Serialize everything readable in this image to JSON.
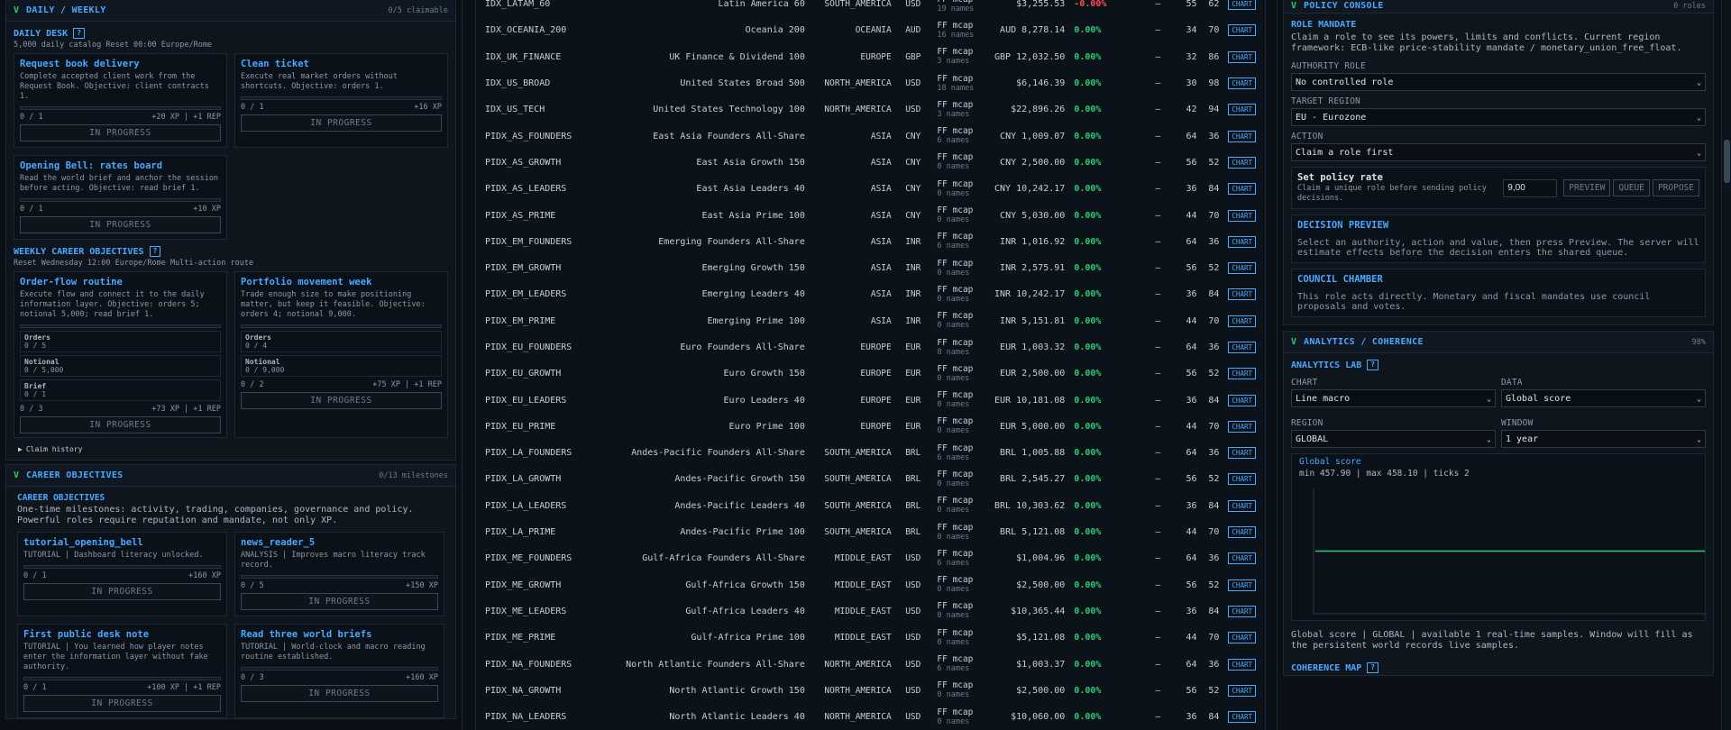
{
  "left": {
    "daily_weekly": {
      "toggle": "V",
      "title": "DAILY / WEEKLY",
      "meta": "0/5 claimable"
    },
    "daily_desk": {
      "title": "DAILY DESK",
      "help": "?",
      "subtitle": "5,000 daily catalog  Reset 00:00 Europe/Rome"
    },
    "daily_cards": [
      {
        "title": "Request book delivery",
        "desc": "Complete accepted client work from the Request Book. Objective: client contracts 1.",
        "progress": "0 / 1",
        "reward": "+20 XP | +1 REP",
        "status": "IN PROGRESS"
      },
      {
        "title": "Clean ticket",
        "desc": "Execute real market orders without shortcuts. Objective: orders 1.",
        "progress": "0 / 1",
        "reward": "+16 XP",
        "status": "IN PROGRESS"
      },
      {
        "title": "Opening Bell: rates board",
        "desc": "Read the world brief and anchor the session before acting. Objective: read brief 1.",
        "progress": "0 / 1",
        "reward": "+10 XP",
        "status": "IN PROGRESS"
      }
    ],
    "weekly": {
      "title": "WEEKLY CAREER OBJECTIVES",
      "help": "?",
      "subtitle": "Reset Wednesday 12:00 Europe/Rome  Multi-action route"
    },
    "weekly_cards": [
      {
        "title": "Order-flow routine",
        "desc": "Execute flow and connect it to the daily information layer. Objective: orders 5; notional 5,000; read brief 1.",
        "metrics": [
          {
            "label": "Orders",
            "value": "0 / 5"
          },
          {
            "label": "Notional",
            "value": "0 / 5,000"
          },
          {
            "label": "Brief",
            "value": "0 / 1"
          }
        ],
        "progress": "0 / 3",
        "reward": "+73 XP | +1 REP",
        "status": "IN PROGRESS"
      },
      {
        "title": "Portfolio movement week",
        "desc": "Trade enough size to make positioning matter, but keep it feasible. Objective: orders 4; notional 9,000.",
        "metrics": [
          {
            "label": "Orders",
            "value": "0 / 4"
          },
          {
            "label": "Notional",
            "value": "0 / 9,000"
          }
        ],
        "progress": "0 / 2",
        "reward": "+75 XP | +1 REP",
        "status": "IN PROGRESS"
      }
    ],
    "claim_history": "Claim history",
    "career": {
      "toggle": "V",
      "title": "CAREER OBJECTIVES",
      "meta": "0/13 milestones",
      "inner_title": "CAREER OBJECTIVES",
      "desc": "One-time milestones: activity, trading, companies, governance and policy. Powerful roles require reputation and mandate, not only XP."
    },
    "career_cards": [
      {
        "title": "tutorial_opening_bell",
        "desc": "TUTORIAL | Dashboard literacy unlocked.",
        "progress": "0 / 1",
        "reward": "+160 XP",
        "status": "IN PROGRESS"
      },
      {
        "title": "news_reader_5",
        "desc": "ANALYSIS | Improves macro literacy track record.",
        "progress": "0 / 5",
        "reward": "+150 XP",
        "status": "IN PROGRESS"
      },
      {
        "title": "First public desk note",
        "desc": "TUTORIAL | You learned how player notes enter the information layer without fake authority.",
        "progress": "0 / 1",
        "reward": "+100 XP | +1 REP",
        "status": "IN PROGRESS"
      },
      {
        "title": "Read three world briefs",
        "desc": "TUTORIAL | World-clock and macro reading routine established.",
        "progress": "0 / 3",
        "reward": "+160 XP",
        "status": "IN PROGRESS"
      }
    ]
  },
  "table": {
    "chart_label": "CHART",
    "ff_label": "FF mcap",
    "rows": [
      {
        "id": "IDX_LATAM_60",
        "name": "Latin America 60",
        "region": "SOUTH_AMERICA",
        "cur": "USD",
        "names": "19 names",
        "value": "$3,255.53",
        "chg": "-0.00%",
        "neg": true,
        "dash": "–",
        "a": "55",
        "b": "62"
      },
      {
        "id": "IDX_OCEANIA_200",
        "name": "Oceania 200",
        "region": "OCEANIA",
        "cur": "AUD",
        "names": "16 names",
        "value": "AUD 8,278.14",
        "chg": "0.00%",
        "dash": "–",
        "a": "34",
        "b": "70"
      },
      {
        "id": "IDX_UK_FINANCE",
        "name": "UK Finance & Dividend 100",
        "region": "EUROPE",
        "cur": "GBP",
        "names": "3 names",
        "value": "GBP 12,032.50",
        "chg": "0.00%",
        "dash": "–",
        "a": "32",
        "b": "86"
      },
      {
        "id": "IDX_US_BROAD",
        "name": "United States Broad 500",
        "region": "NORTH_AMERICA",
        "cur": "USD",
        "names": "18 names",
        "value": "$6,146.39",
        "chg": "0.00%",
        "dash": "–",
        "a": "30",
        "b": "98"
      },
      {
        "id": "IDX_US_TECH",
        "name": "United States Technology 100",
        "region": "NORTH_AMERICA",
        "cur": "USD",
        "names": "3 names",
        "value": "$22,896.26",
        "chg": "0.00%",
        "dash": "–",
        "a": "42",
        "b": "94"
      },
      {
        "id": "PIDX_AS_FOUNDERS",
        "name": "East Asia Founders All-Share",
        "region": "ASIA",
        "cur": "CNY",
        "names": "6 names",
        "value": "CNY 1,009.07",
        "chg": "0.00%",
        "dash": "–",
        "a": "64",
        "b": "36"
      },
      {
        "id": "PIDX_AS_GROWTH",
        "name": "East Asia Growth 150",
        "region": "ASIA",
        "cur": "CNY",
        "names": "0 names",
        "value": "CNY 2,500.00",
        "chg": "0.00%",
        "dash": "–",
        "a": "56",
        "b": "52"
      },
      {
        "id": "PIDX_AS_LEADERS",
        "name": "East Asia Leaders 40",
        "region": "ASIA",
        "cur": "CNY",
        "names": "0 names",
        "value": "CNY 10,242.17",
        "chg": "0.00%",
        "dash": "–",
        "a": "36",
        "b": "84"
      },
      {
        "id": "PIDX_AS_PRIME",
        "name": "East Asia Prime 100",
        "region": "ASIA",
        "cur": "CNY",
        "names": "0 names",
        "value": "CNY 5,030.00",
        "chg": "0.00%",
        "dash": "–",
        "a": "44",
        "b": "70"
      },
      {
        "id": "PIDX_EM_FOUNDERS",
        "name": "Emerging Founders All-Share",
        "region": "ASIA",
        "cur": "INR",
        "names": "6 names",
        "value": "INR 1,016.92",
        "chg": "0.00%",
        "dash": "–",
        "a": "64",
        "b": "36"
      },
      {
        "id": "PIDX_EM_GROWTH",
        "name": "Emerging Growth 150",
        "region": "ASIA",
        "cur": "INR",
        "names": "0 names",
        "value": "INR 2,575.91",
        "chg": "0.00%",
        "dash": "–",
        "a": "56",
        "b": "52"
      },
      {
        "id": "PIDX_EM_LEADERS",
        "name": "Emerging Leaders 40",
        "region": "ASIA",
        "cur": "INR",
        "names": "0 names",
        "value": "INR 10,242.17",
        "chg": "0.00%",
        "dash": "–",
        "a": "36",
        "b": "84"
      },
      {
        "id": "PIDX_EM_PRIME",
        "name": "Emerging Prime 100",
        "region": "ASIA",
        "cur": "INR",
        "names": "0 names",
        "value": "INR 5,151.81",
        "chg": "0.00%",
        "dash": "–",
        "a": "44",
        "b": "70"
      },
      {
        "id": "PIDX_EU_FOUNDERS",
        "name": "Euro Founders All-Share",
        "region": "EUROPE",
        "cur": "EUR",
        "names": "8 names",
        "value": "EUR 1,003.32",
        "chg": "0.00%",
        "dash": "–",
        "a": "64",
        "b": "36"
      },
      {
        "id": "PIDX_EU_GROWTH",
        "name": "Euro Growth 150",
        "region": "EUROPE",
        "cur": "EUR",
        "names": "0 names",
        "value": "EUR 2,500.00",
        "chg": "0.00%",
        "dash": "–",
        "a": "56",
        "b": "52"
      },
      {
        "id": "PIDX_EU_LEADERS",
        "name": "Euro Leaders 40",
        "region": "EUROPE",
        "cur": "EUR",
        "names": "0 names",
        "value": "EUR 10,181.08",
        "chg": "0.00%",
        "dash": "–",
        "a": "36",
        "b": "84"
      },
      {
        "id": "PIDX_EU_PRIME",
        "name": "Euro Prime 100",
        "region": "EUROPE",
        "cur": "EUR",
        "names": "0 names",
        "value": "EUR 5,000.00",
        "chg": "0.00%",
        "dash": "–",
        "a": "44",
        "b": "70"
      },
      {
        "id": "PIDX_LA_FOUNDERS",
        "name": "Andes-Pacific Founders All-Share",
        "region": "SOUTH_AMERICA",
        "cur": "BRL",
        "names": "6 names",
        "value": "BRL 1,005.88",
        "chg": "0.00%",
        "dash": "–",
        "a": "64",
        "b": "36"
      },
      {
        "id": "PIDX_LA_GROWTH",
        "name": "Andes-Pacific Growth 150",
        "region": "SOUTH_AMERICA",
        "cur": "BRL",
        "names": "0 names",
        "value": "BRL 2,545.27",
        "chg": "0.00%",
        "dash": "–",
        "a": "56",
        "b": "52"
      },
      {
        "id": "PIDX_LA_LEADERS",
        "name": "Andes-Pacific Leaders 40",
        "region": "SOUTH_AMERICA",
        "cur": "BRL",
        "names": "0 names",
        "value": "BRL 10,303.62",
        "chg": "0.00%",
        "dash": "–",
        "a": "36",
        "b": "84"
      },
      {
        "id": "PIDX_LA_PRIME",
        "name": "Andes-Pacific Prime 100",
        "region": "SOUTH_AMERICA",
        "cur": "BRL",
        "names": "0 names",
        "value": "BRL 5,121.08",
        "chg": "0.00%",
        "dash": "–",
        "a": "44",
        "b": "70"
      },
      {
        "id": "PIDX_ME_FOUNDERS",
        "name": "Gulf-Africa Founders All-Share",
        "region": "MIDDLE_EAST",
        "cur": "USD",
        "names": "6 names",
        "value": "$1,004.96",
        "chg": "0.00%",
        "dash": "–",
        "a": "64",
        "b": "36"
      },
      {
        "id": "PIDX_ME_GROWTH",
        "name": "Gulf-Africa Growth 150",
        "region": "MIDDLE_EAST",
        "cur": "USD",
        "names": "0 names",
        "value": "$2,500.00",
        "chg": "0.00%",
        "dash": "–",
        "a": "56",
        "b": "52"
      },
      {
        "id": "PIDX_ME_LEADERS",
        "name": "Gulf-Africa Leaders 40",
        "region": "MIDDLE_EAST",
        "cur": "USD",
        "names": "0 names",
        "value": "$10,365.44",
        "chg": "0.00%",
        "dash": "–",
        "a": "36",
        "b": "84"
      },
      {
        "id": "PIDX_ME_PRIME",
        "name": "Gulf-Africa Prime 100",
        "region": "MIDDLE_EAST",
        "cur": "USD",
        "names": "0 names",
        "value": "$5,121.08",
        "chg": "0.00%",
        "dash": "–",
        "a": "44",
        "b": "70"
      },
      {
        "id": "PIDX_NA_FOUNDERS",
        "name": "North Atlantic Founders All-Share",
        "region": "NORTH_AMERICA",
        "cur": "USD",
        "names": "6 names",
        "value": "$1,003.37",
        "chg": "0.00%",
        "dash": "–",
        "a": "64",
        "b": "36"
      },
      {
        "id": "PIDX_NA_GROWTH",
        "name": "North Atlantic Growth 150",
        "region": "NORTH_AMERICA",
        "cur": "USD",
        "names": "0 names",
        "value": "$2,500.00",
        "chg": "0.00%",
        "dash": "–",
        "a": "56",
        "b": "52"
      },
      {
        "id": "PIDX_NA_LEADERS",
        "name": "North Atlantic Leaders 40",
        "region": "NORTH_AMERICA",
        "cur": "USD",
        "names": "0 names",
        "value": "$10,060.00",
        "chg": "0.00%",
        "dash": "–",
        "a": "36",
        "b": "84"
      }
    ]
  },
  "right": {
    "policy": {
      "toggle": "V",
      "title": "POLICY CONSOLE",
      "meta": "0 roles",
      "mandate_title": "ROLE MANDATE",
      "mandate_text": "Claim a role to see its powers, limits and conflicts. Current region framework: ECB-like price-stability mandate / monetary_union_free_float.",
      "authority_label": "AUTHORITY ROLE",
      "authority_value": "No controlled role",
      "region_label": "TARGET REGION",
      "region_value": "EU - Eurozone",
      "action_label": "ACTION",
      "action_value": "Claim a role first",
      "rate_title": "Set policy rate",
      "rate_desc": "Claim a unique role before sending policy decisions.",
      "rate_value": "9,00",
      "preview": "PREVIEW",
      "queue": "QUEUE",
      "propose": "PROPOSE",
      "decision_title": "DECISION PREVIEW",
      "decision_text": "Select an authority, action and value, then press Preview. The server will estimate effects before the decision enters the shared queue.",
      "council_title": "COUNCIL CHAMBER",
      "council_text": "This role acts directly. Monetary and fiscal mandates use council proposals and votes."
    },
    "analytics": {
      "toggle": "V",
      "title": "ANALYTICS / COHERENCE",
      "meta": "98%",
      "lab_title": "ANALYTICS LAB",
      "help": "?",
      "chart_label": "CHART",
      "chart_value": "Line macro",
      "data_label": "DATA",
      "data_value": "Global score",
      "region_label": "REGION",
      "region_value": "GLOBAL",
      "window_label": "WINDOW",
      "window_value": "1 year",
      "plot_title": "Global score",
      "plot_meta": "min 457.90 | max 458.10 | ticks 2",
      "footer": "Global score | GLOBAL | available 1 real-time samples. Window will fill as the persistent world records live samples.",
      "coherence_title": "COHERENCE MAP",
      "coherence_help": "?"
    }
  },
  "colors": {
    "accent": "#4aa8ff",
    "positive": "#2ecc71",
    "negative": "#ff4d4d",
    "background": "#0b1017"
  },
  "chart_data": {
    "type": "line",
    "title": "Global score",
    "series": [
      {
        "name": "Global score",
        "values": [
          458.0,
          458.0
        ]
      }
    ],
    "ylim": [
      457.9,
      458.1
    ]
  }
}
